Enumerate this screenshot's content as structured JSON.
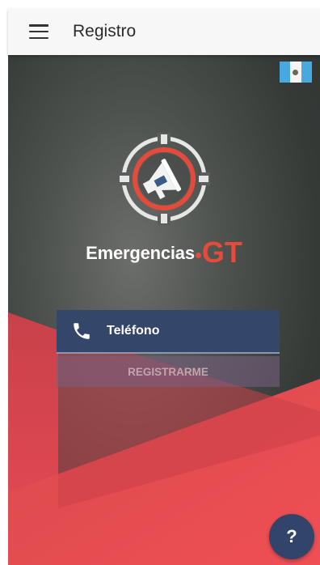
{
  "appbar": {
    "title": "Registro",
    "menu_icon": "menu-icon"
  },
  "flag": {
    "icon": "guatemala-flag-icon",
    "colors": {
      "blue": "#4aa8e0",
      "white": "#f4f4f4"
    }
  },
  "brand": {
    "name": "Emergencias",
    "suffix": "GT",
    "logo_icon": "megaphone-target-icon"
  },
  "form": {
    "phone_placeholder": "Teléfono",
    "phone_value": "",
    "phone_icon": "phone-icon",
    "register_label": "REGISTRARME"
  },
  "help": {
    "label": "?"
  },
  "colors": {
    "accent": "#e54b3b",
    "navy": "#34466a",
    "appbar": "#f7f7f7",
    "background_dark": "#3f4340"
  }
}
